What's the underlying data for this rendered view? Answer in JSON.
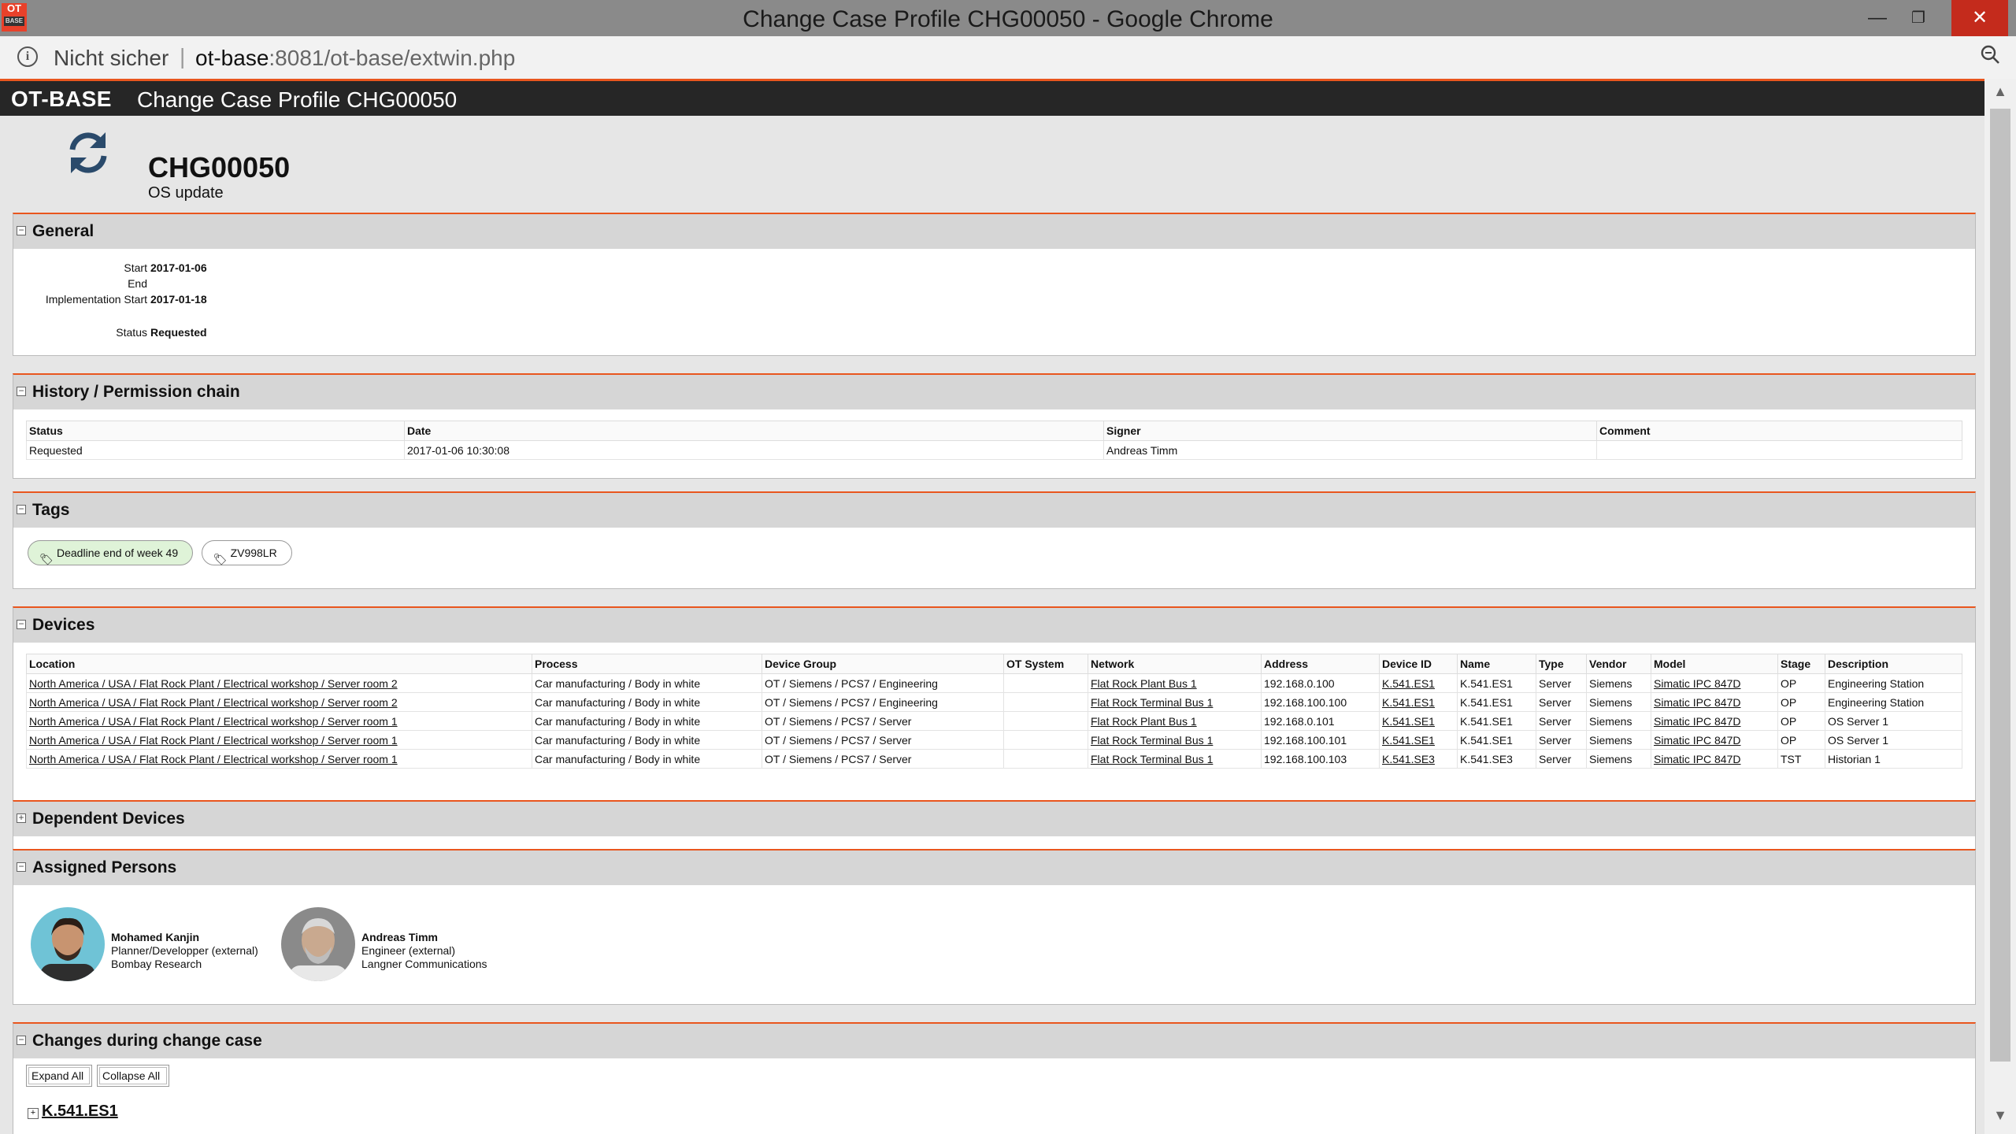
{
  "window": {
    "title": "Change Case Profile CHG00050 - Google Chrome",
    "app_icon_text": "OT",
    "app_icon_sub": "BASE",
    "minimize": "—",
    "maximize": "❐",
    "close": "✕"
  },
  "addressbar": {
    "security_label": "Nicht sicher",
    "separator": "|",
    "host": "ot-base",
    "path": ":8081/ot-base/extwin.php",
    "info_icon": "info-icon",
    "zoom_icon": "zoom-icon"
  },
  "appbar": {
    "brand": "OT-BASE",
    "page_title": "Change Case Profile  CHG00050"
  },
  "header": {
    "case_id": "CHG00050",
    "subtitle": "OS update",
    "icon": "refresh-icon"
  },
  "general": {
    "title": "General",
    "toggle": "−",
    "fields": [
      {
        "label": "Start",
        "value": "2017-01-06"
      },
      {
        "label": "End",
        "value": ""
      },
      {
        "label": "Implementation Start",
        "value": "2017-01-18"
      },
      {
        "label": "Status",
        "value": "Requested"
      }
    ]
  },
  "history": {
    "title": "History / Permission chain",
    "toggle": "−",
    "columns": [
      "Status",
      "Date",
      "Signer",
      "Comment"
    ],
    "rows": [
      [
        "Requested",
        "2017-01-06 10:30:08",
        "Andreas Timm",
        ""
      ]
    ]
  },
  "tags": {
    "title": "Tags",
    "toggle": "−",
    "items": [
      {
        "label": "Deadline end of week 49",
        "color": "#dff3d8"
      },
      {
        "label": "ZV998LR",
        "color": "#ffffff"
      }
    ]
  },
  "devices": {
    "title": "Devices",
    "toggle": "−",
    "columns": [
      "Location",
      "Process",
      "Device Group",
      "OT System",
      "Network",
      "Address",
      "Device ID",
      "Name",
      "Type",
      "Vendor",
      "Model",
      "Stage",
      "Description"
    ],
    "rows": [
      [
        "North America / USA / Flat Rock Plant / Electrical workshop / Server room 2",
        "Car manufacturing / Body in white",
        "OT / Siemens / PCS7 / Engineering",
        "",
        "Flat Rock Plant Bus 1",
        "192.168.0.100",
        "K.541.ES1",
        "K.541.ES1",
        "Server",
        "Siemens",
        "Simatic IPC 847D",
        "OP",
        "Engineering Station"
      ],
      [
        "North America / USA / Flat Rock Plant / Electrical workshop / Server room 2",
        "Car manufacturing / Body in white",
        "OT / Siemens / PCS7 / Engineering",
        "",
        "Flat Rock Terminal Bus 1",
        "192.168.100.100",
        "K.541.ES1",
        "K.541.ES1",
        "Server",
        "Siemens",
        "Simatic IPC 847D",
        "OP",
        "Engineering Station"
      ],
      [
        "North America / USA / Flat Rock Plant / Electrical workshop / Server room 1",
        "Car manufacturing / Body in white",
        "OT / Siemens / PCS7 / Server",
        "",
        "Flat Rock Plant Bus 1",
        "192.168.0.101",
        "K.541.SE1",
        "K.541.SE1",
        "Server",
        "Siemens",
        "Simatic IPC 847D",
        "OP",
        "OS Server 1"
      ],
      [
        "North America / USA / Flat Rock Plant / Electrical workshop / Server room 1",
        "Car manufacturing / Body in white",
        "OT / Siemens / PCS7 / Server",
        "",
        "Flat Rock Terminal Bus 1",
        "192.168.100.101",
        "K.541.SE1",
        "K.541.SE1",
        "Server",
        "Siemens",
        "Simatic IPC 847D",
        "OP",
        "OS Server 1"
      ],
      [
        "North America / USA / Flat Rock Plant / Electrical workshop / Server room 1",
        "Car manufacturing / Body in white",
        "OT / Siemens / PCS7 / Server",
        "",
        "Flat Rock Terminal Bus 1",
        "192.168.100.103",
        "K.541.SE3",
        "K.541.SE3",
        "Server",
        "Siemens",
        "Simatic IPC 847D",
        "TST",
        "Historian 1"
      ]
    ]
  },
  "dependent_devices": {
    "title": "Dependent Devices",
    "toggle": "+"
  },
  "assigned_persons": {
    "title": "Assigned Persons",
    "toggle": "−",
    "people": [
      {
        "name": "Mohamed Kanjin",
        "role": "Planner/Developper (external)",
        "org": "Bombay Research"
      },
      {
        "name": "Andreas Timm",
        "role": "Engineer (external)",
        "org": "Langner Communications"
      }
    ]
  },
  "changes": {
    "title": "Changes during change case",
    "toggle": "−",
    "expand_all": "Expand All",
    "collapse_all": "Collapse All",
    "first_item": "K.541.ES1",
    "first_item_toggle": "+"
  }
}
